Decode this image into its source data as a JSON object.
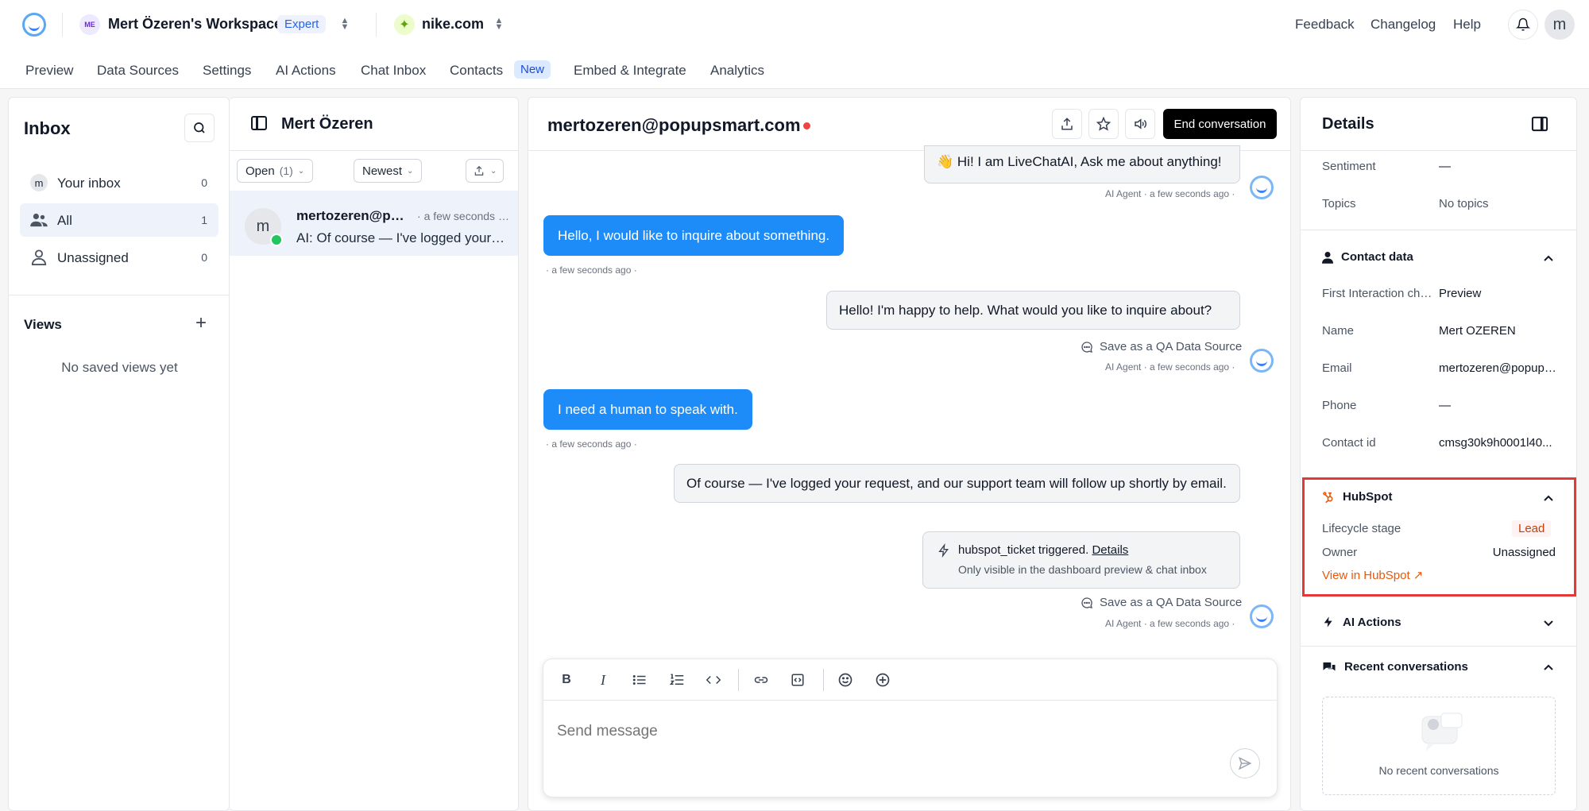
{
  "topbar": {
    "workspace_initials": "ME",
    "workspace_name": "Mert Özeren's Workspace",
    "plan_badge": "Expert",
    "site_name": "nike.com",
    "links": [
      "Feedback",
      "Changelog",
      "Help"
    ],
    "user_initial": "m"
  },
  "nav": {
    "tabs": [
      "Preview",
      "Data Sources",
      "Settings",
      "AI Actions",
      "Chat Inbox",
      "Contacts",
      "Embed & Integrate",
      "Analytics"
    ],
    "new_badge": "New"
  },
  "inbox": {
    "title": "Inbox",
    "items": [
      {
        "label": "Your inbox",
        "count": "0",
        "avatar": "m"
      },
      {
        "label": "All",
        "count": "1"
      },
      {
        "label": "Unassigned",
        "count": "0"
      }
    ],
    "views_title": "Views",
    "no_views": "No saved views yet"
  },
  "list": {
    "header_name": "Mert Özeren",
    "filter_status": "Open",
    "filter_count": "(1)",
    "sort": "Newest",
    "conversation": {
      "avatar": "m",
      "name": "mertozeren@popupsmart.com",
      "time": "a few seconds ago",
      "preview": "AI: Of course — I've logged your request, and our support team will follow up shortly by email."
    }
  },
  "chat": {
    "title": "mertozeren@popupsmart.com",
    "end_button": "End conversation",
    "messages": [
      {
        "text": "Hi! I am LiveChatAI, Ask me about anything!",
        "emoji": "👋",
        "meta": "AI Agent · a few seconds ago ·"
      },
      {
        "text": "Hello, I would like to inquire about something.",
        "meta": "· a few seconds ago ·"
      },
      {
        "text": "Hello! I'm happy to help. What would you like to inquire about?",
        "meta": "AI Agent · a few seconds ago ·"
      },
      {
        "text": "I need a human to speak with.",
        "meta": "· a few seconds ago ·"
      },
      {
        "text": "Of course — I've logged your request, and our support team will follow up shortly by email.",
        "meta": "AI Agent · a few seconds ago ·"
      }
    ],
    "save_qa": "Save as a QA Data Source",
    "trigger": {
      "text": "hubspot_ticket triggered.",
      "link": "Details",
      "sub": "Only visible in the dashboard preview & chat inbox"
    },
    "composer_placeholder": "Send message"
  },
  "details": {
    "title": "Details",
    "sentiment_label": "Sentiment",
    "sentiment_value": "—",
    "topics_label": "Topics",
    "topics_value": "No topics",
    "contact_section": "Contact data",
    "contact_rows": [
      {
        "label": "First Interaction channel",
        "value": "Preview"
      },
      {
        "label": "Name",
        "value": "Mert OZEREN"
      },
      {
        "label": "Email",
        "value": "mertozeren@popupsmart.com"
      },
      {
        "label": "Phone",
        "value": "—"
      },
      {
        "label": "Contact id",
        "value": "cmsg30k9h0001l40..."
      }
    ],
    "hubspot_section": "HubSpot",
    "lifecycle_label": "Lifecycle stage",
    "lifecycle_value": "Lead",
    "owner_label": "Owner",
    "owner_value": "Unassigned",
    "hubspot_link": "View in HubSpot ↗",
    "ai_actions_section": "AI Actions",
    "recent_section": "Recent conversations",
    "recent_empty": "No recent conversations"
  },
  "colors": {
    "accent_blue": "#1d8cf8",
    "hubspot_orange": "#ea580c",
    "highlight_red": "#e53935",
    "online_green": "#22c55e"
  }
}
